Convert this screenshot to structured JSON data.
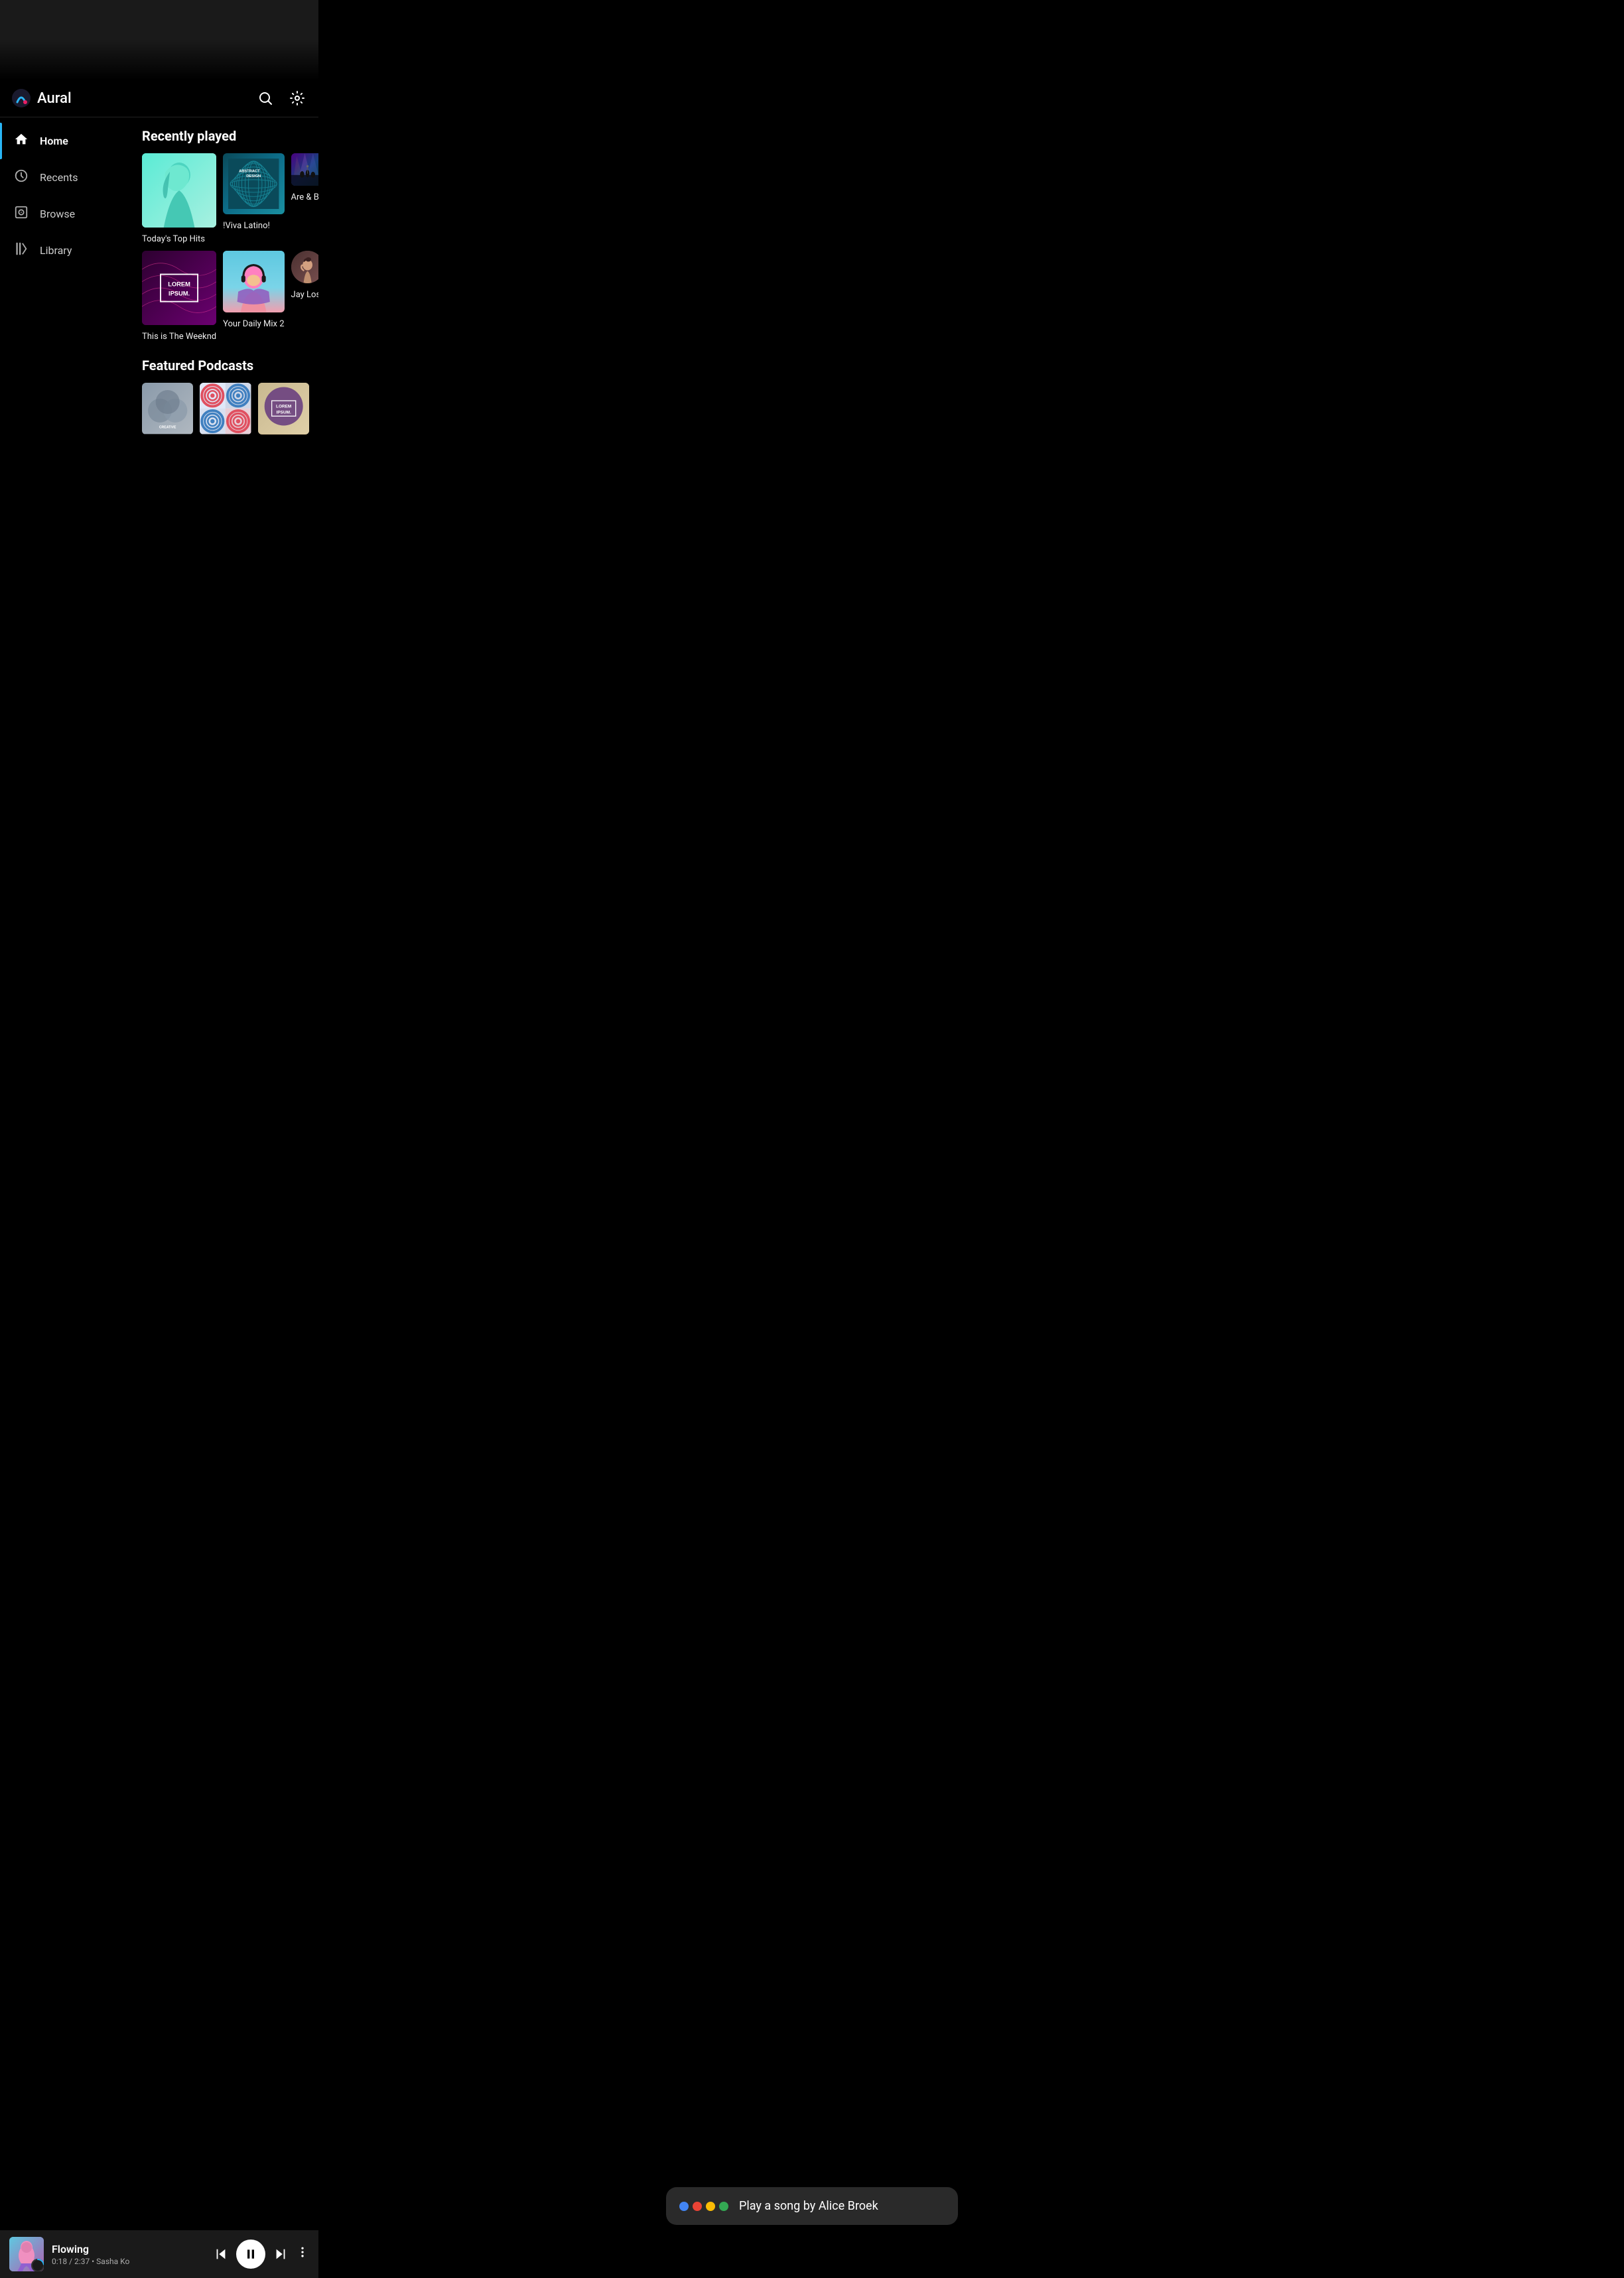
{
  "app": {
    "name": "Aural",
    "logo_unicode": "🎵"
  },
  "header": {
    "search_label": "search",
    "settings_label": "settings"
  },
  "sidebar": {
    "items": [
      {
        "id": "home",
        "label": "Home",
        "icon": "🏠",
        "active": true
      },
      {
        "id": "recents",
        "label": "Recents",
        "icon": "🕐",
        "active": false
      },
      {
        "id": "browse",
        "label": "Browse",
        "icon": "📷",
        "active": false
      },
      {
        "id": "library",
        "label": "Library",
        "icon": "📚",
        "active": false
      }
    ]
  },
  "recently_played": {
    "title": "Recently played",
    "items": [
      {
        "id": "top-hits",
        "label": "Today's Top Hits"
      },
      {
        "id": "viva-latino",
        "label": "!Viva Latino!"
      },
      {
        "id": "are-be",
        "label": "Are & Be"
      },
      {
        "id": "the-weeknd",
        "label": "This is The Weeknd"
      },
      {
        "id": "daily-mix-2",
        "label": "Your Daily Mix 2"
      },
      {
        "id": "jay-los",
        "label": "Jay Los"
      }
    ]
  },
  "featured_podcasts": {
    "title": "Featured Podcasts",
    "items": [
      {
        "id": "creative",
        "label": "Creative"
      },
      {
        "id": "circles",
        "label": "Circles"
      },
      {
        "id": "lorem-ipsum-2",
        "label": "Lorem Ipsum"
      }
    ]
  },
  "voice_assistant": {
    "text": "Play a song by Alice Broek",
    "dots": [
      {
        "color": "#4285F4"
      },
      {
        "color": "#EA4335"
      },
      {
        "color": "#FBBC05"
      },
      {
        "color": "#34A853"
      }
    ]
  },
  "now_playing": {
    "title": "Flowing",
    "time": "0:18 / 2:37",
    "artist": "Sasha Ko",
    "meta": "0:18 / 2:37 • Sasha Ko"
  },
  "lorem_ipsum": {
    "text": "LOREM\nIPSUM."
  },
  "abstract_design": {
    "text": "ABSTRACT\nDESIGN"
  },
  "creative_text": "CREATIVE"
}
